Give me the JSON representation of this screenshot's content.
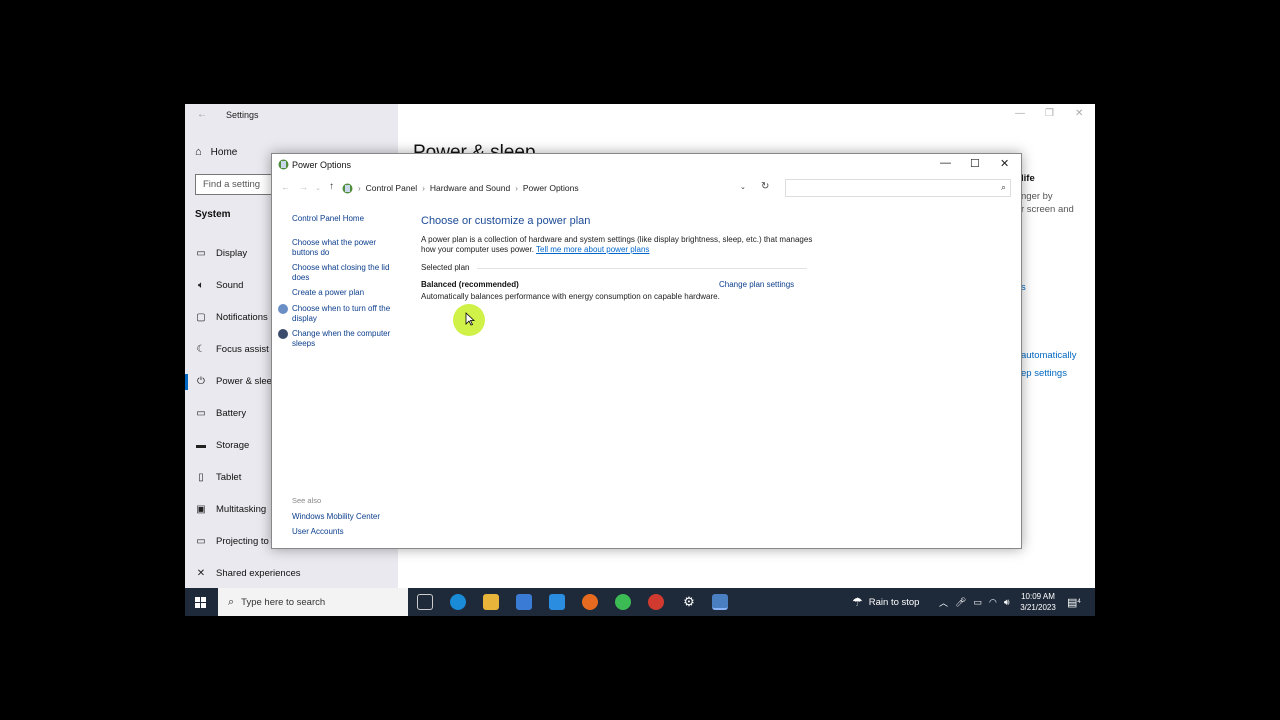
{
  "settings": {
    "title": "Settings",
    "home": "Home",
    "find_placeholder": "Find a setting",
    "section": "System",
    "items": [
      "Display",
      "Sound",
      "Notifications",
      "Focus assist",
      "Power & sleep",
      "Battery",
      "Storage",
      "Tablet",
      "Multitasking",
      "Projecting to",
      "Shared experiences"
    ],
    "heading": "Power & sleep",
    "right_texts": [
      "life",
      "nger by",
      "r screen and",
      "s"
    ],
    "right_links": [
      "automatically",
      "ep settings"
    ]
  },
  "power_options": {
    "title": "Power Options",
    "breadcrumb": [
      "Control Panel",
      "Hardware and Sound",
      "Power Options"
    ],
    "left_links": [
      "Control Panel Home",
      "Choose what the power buttons do",
      "Choose what closing the lid does",
      "Create a power plan",
      "Choose when to turn off the display",
      "Change when the computer sleeps"
    ],
    "see_also_label": "See also",
    "see_also_links": [
      "Windows Mobility Center",
      "User Accounts"
    ],
    "main": {
      "heading": "Choose or customize a power plan",
      "description": "A power plan is a collection of hardware and system settings (like display brightness, sleep, etc.) that manages how your computer uses power.",
      "learn_link": "Tell me more about power plans",
      "selected_plan_label": "Selected plan",
      "plan_name": "Balanced (recommended)",
      "plan_description": "Automatically balances performance with energy consumption on capable hardware.",
      "change_link": "Change plan settings"
    }
  },
  "taskbar": {
    "search_placeholder": "Type here to search",
    "weather": "Rain to stop",
    "time": "10:09 AM",
    "date": "3/21/2023",
    "notification_count": "4"
  }
}
